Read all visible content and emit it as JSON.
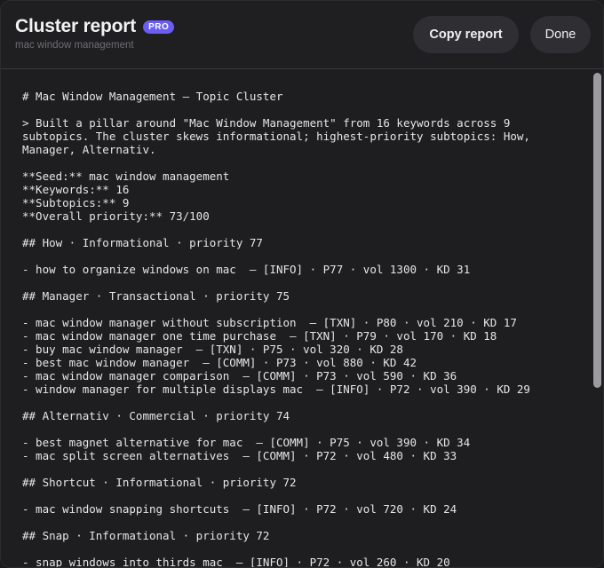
{
  "header": {
    "title": "Cluster report",
    "badge": "PRO",
    "subtitle": "mac window management",
    "copy_label": "Copy report",
    "done_label": "Done"
  },
  "report": {
    "lines": [
      "# Mac Window Management — Topic Cluster",
      "",
      "> Built a pillar around \"Mac Window Management\" from 16 keywords across 9",
      "subtopics. The cluster skews informational; highest-priority subtopics: How,",
      "Manager, Alternativ.",
      "",
      "**Seed:** mac window management",
      "**Keywords:** 16",
      "**Subtopics:** 9",
      "**Overall priority:** 73/100",
      "",
      "## How · Informational · priority 77",
      "",
      "- how to organize windows on mac  — [INFO] · P77 · vol 1300 · KD 31",
      "",
      "## Manager · Transactional · priority 75",
      "",
      "- mac window manager without subscription  — [TXN] · P80 · vol 210 · KD 17",
      "- mac window manager one time purchase  — [TXN] · P79 · vol 170 · KD 18",
      "- buy mac window manager  — [TXN] · P75 · vol 320 · KD 28",
      "- best mac window manager  — [COMM] · P73 · vol 880 · KD 42",
      "- mac window manager comparison  — [COMM] · P73 · vol 590 · KD 36",
      "- window manager for multiple displays mac  — [INFO] · P72 · vol 390 · KD 29",
      "",
      "## Alternativ · Commercial · priority 74",
      "",
      "- best magnet alternative for mac  — [COMM] · P75 · vol 390 · KD 34",
      "- mac split screen alternatives  — [COMM] · P72 · vol 480 · KD 33",
      "",
      "## Shortcut · Informational · priority 72",
      "",
      "- mac window snapping shortcuts  — [INFO] · P72 · vol 720 · KD 24",
      "",
      "## Snap · Informational · priority 72",
      "",
      "- snap windows into thirds mac  — [INFO] · P72 · vol 260 · KD 20"
    ]
  },
  "colors": {
    "accent": "#6b5cf2",
    "background": "#1e1e20",
    "text": "#e6e6e8",
    "muted": "#6e6e74"
  }
}
